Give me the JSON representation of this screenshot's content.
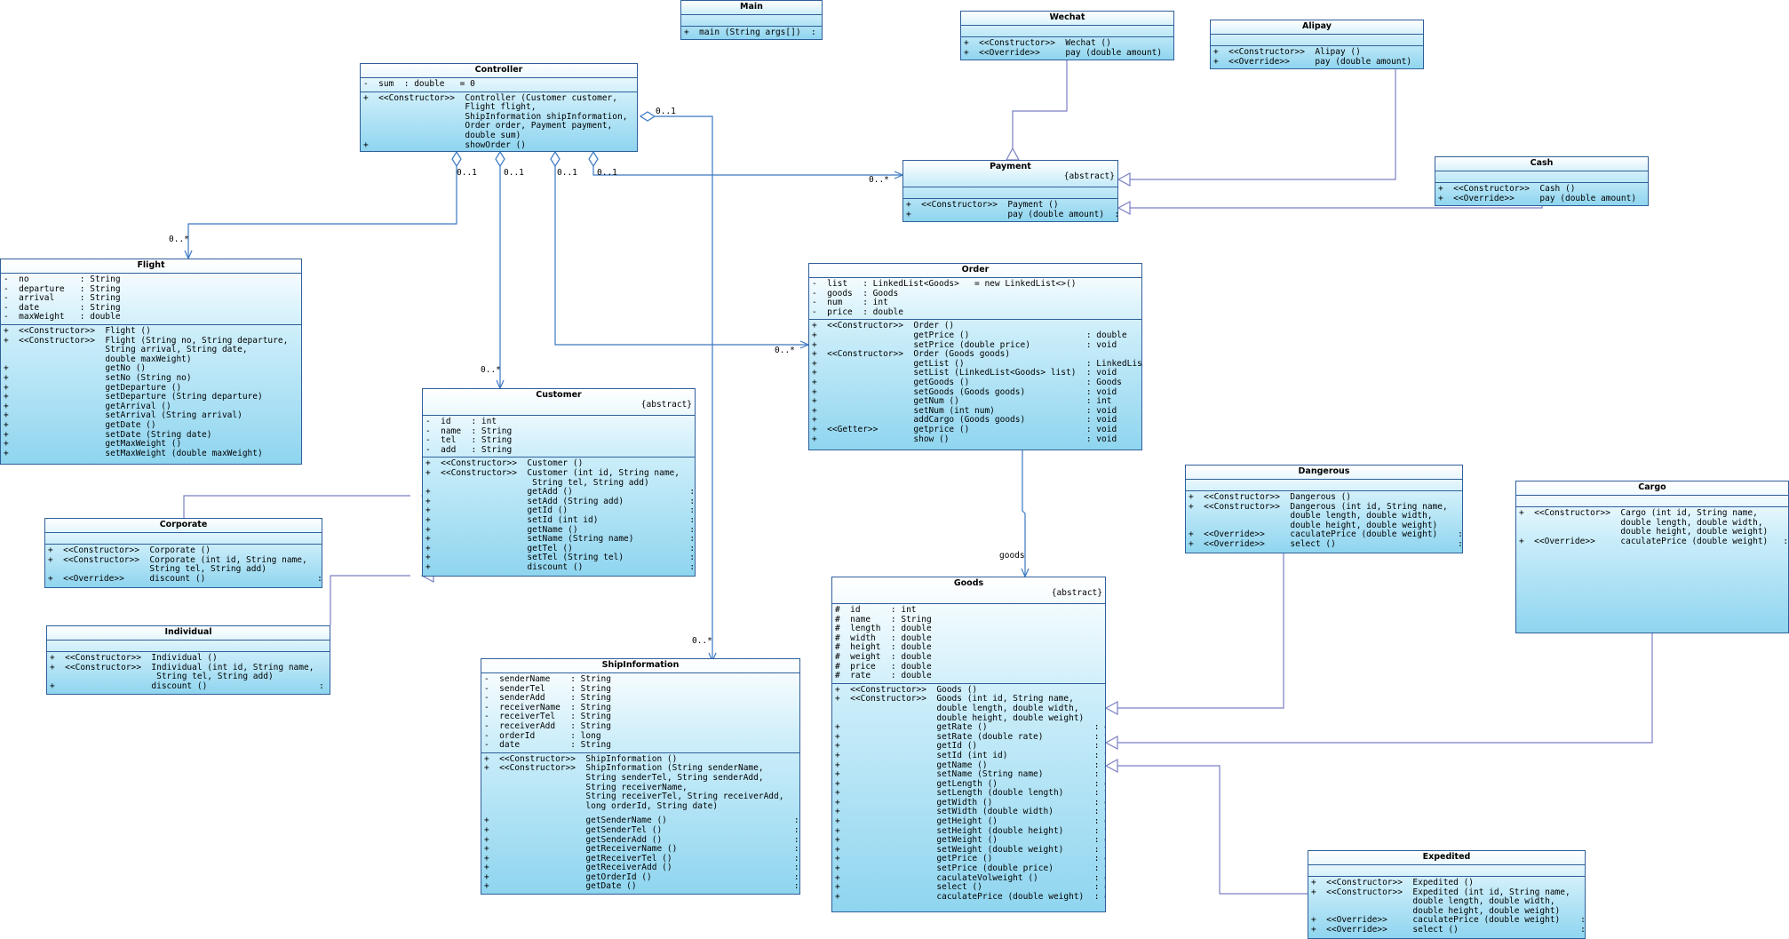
{
  "classes": [
    {
      "key": "Main",
      "name": "Main",
      "stereotype": "",
      "attrs": [],
      "ops": [
        "+  main (String args[])  : void"
      ]
    },
    {
      "key": "Wechat",
      "name": "Wechat",
      "stereotype": "",
      "attrs": [],
      "ops": [
        "+  <<Constructor>>  Wechat ()",
        "+  <<Override>>     pay (double amount)  : void"
      ]
    },
    {
      "key": "Alipay",
      "name": "Alipay",
      "stereotype": "",
      "attrs": [],
      "ops": [
        "+  <<Constructor>>  Alipay ()",
        "+  <<Override>>     pay (double amount)  : void"
      ]
    },
    {
      "key": "Controller",
      "name": "Controller",
      "stereotype": "",
      "attrs": [
        "-  sum  : double   = 0"
      ],
      "ops": [
        "+  <<Constructor>>  Controller (Customer customer,",
        "                    Flight flight,",
        "                    ShipInformation shipInformation,",
        "                    Order order, Payment payment,",
        "                    double sum)",
        "+                   showOrder ()                         : void"
      ]
    },
    {
      "key": "Payment",
      "name": "Payment",
      "stereotype": "{abstract}",
      "attrs": [],
      "ops": [
        "+  <<Constructor>>  Payment ()",
        "+                   pay (double amount)  : void"
      ]
    },
    {
      "key": "Cash",
      "name": "Cash",
      "stereotype": "",
      "attrs": [],
      "ops": [
        "+  <<Constructor>>  Cash ()",
        "+  <<Override>>     pay (double amount)  : void"
      ]
    },
    {
      "key": "Flight",
      "name": "Flight",
      "stereotype": "",
      "attrs": [
        "-  no          : String",
        "-  departure   : String",
        "-  arrival     : String",
        "-  date        : String",
        "-  maxWeight   : double"
      ],
      "ops": [
        "+  <<Constructor>>  Flight ()",
        "+  <<Constructor>>  Flight (String no, String departure,",
        "                    String arrival, String date,",
        "                    double maxWeight)",
        "+                   getNo ()                                : String",
        "+                   setNo (String no)                       : void",
        "+                   getDeparture ()                         : String",
        "+                   setDeparture (String departure)         : void",
        "+                   getArrival ()                           : String",
        "+                   setArrival (String arrival)             : void",
        "+                   getDate ()                              : String",
        "+                   setDate (String date)                   : void",
        "+                   getMaxWeight ()                         : double",
        "+                   setMaxWeight (double maxWeight)         : void"
      ]
    },
    {
      "key": "Order",
      "name": "Order",
      "stereotype": "",
      "attrs": [
        "-  list   : LinkedList<Goods>   = new LinkedList<>()",
        "-  goods  : Goods",
        "-  num    : int",
        "-  price  : double"
      ],
      "ops": [
        "+  <<Constructor>>  Order ()",
        "+                   getPrice ()                       : double",
        "+                   setPrice (double price)           : void",
        "+  <<Constructor>>  Order (Goods goods)",
        "+                   getList ()                        : LinkedList<Goods>",
        "+                   setList (LinkedList<Goods> list)  : void",
        "+                   getGoods ()                       : Goods",
        "+                   setGoods (Goods goods)            : void",
        "+                   getNum ()                         : int",
        "+                   setNum (int num)                  : void",
        "+                   addCargo (Goods goods)            : void",
        "+  <<Getter>>       getprice ()                       : void",
        "+                   show ()                           : void"
      ]
    },
    {
      "key": "Customer",
      "name": "Customer",
      "stereotype": "{abstract}",
      "attrs": [
        "-  id    : int",
        "-  name  : String",
        "-  tel   : String",
        "-  add   : String"
      ],
      "ops": [
        "+  <<Constructor>>  Customer ()",
        "+  <<Constructor>>  Customer (int id, String name,",
        "                     String tel, String add)",
        "+                   getAdd ()                       : String",
        "+                   setAdd (String add)             : void",
        "+                   getId ()                        : int",
        "+                   setId (int id)                  : void",
        "+                   getName ()                      : String",
        "+                   setName (String name)           : void",
        "+                   getTel ()                       : String",
        "+                   setTel (String tel)             : void",
        "+                   discount ()                     : double"
      ]
    },
    {
      "key": "Corporate",
      "name": "Corporate",
      "stereotype": "",
      "attrs": [],
      "ops": [
        "+  <<Constructor>>  Corporate ()",
        "+  <<Constructor>>  Corporate (int id, String name,",
        "                    String tel, String add)",
        "+  <<Override>>     discount ()                      : double"
      ]
    },
    {
      "key": "Individual",
      "name": "Individual",
      "stereotype": "",
      "attrs": [],
      "ops": [
        "+  <<Constructor>>  Individual ()",
        "+  <<Constructor>>  Individual (int id, String name,",
        "                     String tel, String add)",
        "+                   discount ()                      : double"
      ]
    },
    {
      "key": "ShipInformation",
      "name": "ShipInformation",
      "stereotype": "",
      "attrs": [
        "-  senderName    : String",
        "-  senderTel     : String",
        "-  senderAdd     : String",
        "-  receiverName  : String",
        "-  receiverTel   : String",
        "-  receiverAdd   : String",
        "-  orderId       : long",
        "-  date          : String"
      ],
      "ops": [
        "+  <<Constructor>>  ShipInformation ()",
        "+  <<Constructor>>  ShipInformation (String senderName,",
        "                    String senderTel, String senderAdd,",
        "                    String receiverName,",
        "                    String receiverTel, String receiverAdd,",
        "                    long orderId, String date)",
        "",
        "+                   getSenderName ()                         : String",
        "+                   getSenderTel ()                          : String",
        "+                   getSenderAdd ()                          : String",
        "+                   getReceiverName ()                       : String",
        "+                   getReceiverTel ()                        : String",
        "+                   getReceiverAdd ()                        : String",
        "+                   getOrderId ()                            : long",
        "+                   getDate ()                               : String"
      ]
    },
    {
      "key": "Dangerous",
      "name": "Dangerous",
      "stereotype": "",
      "attrs": [],
      "ops": [
        "+  <<Constructor>>  Dangerous ()",
        "+  <<Constructor>>  Dangerous (int id, String name,",
        "                    double length, double width,",
        "                    double height, double weight)",
        "+  <<Override>>     caculatePrice (double weight)    : double",
        "+  <<Override>>     select ()                        : double"
      ]
    },
    {
      "key": "Cargo",
      "name": "Cargo",
      "stereotype": "",
      "attrs": [],
      "ops": [
        "+  <<Constructor>>  Cargo (int id, String name,",
        "                    double length, double width,",
        "                    double height, double weight)",
        "+  <<Override>>     caculatePrice (double weight)   : double"
      ]
    },
    {
      "key": "Goods",
      "name": "Goods",
      "stereotype": "{abstract}",
      "attrs": [
        "#  id      : int",
        "#  name    : String",
        "#  length  : double",
        "#  width   : double",
        "#  height  : double",
        "#  weight  : double",
        "#  price   : double",
        "#  rate    : double"
      ],
      "ops": [
        "+  <<Constructor>>  Goods ()",
        "+  <<Constructor>>  Goods (int id, String name,",
        "                    double length, double width,",
        "                    double height, double weight)",
        "+                   getRate ()                     : double",
        "+                   setRate (double rate)          : void",
        "+                   getId ()                       : int",
        "+                   setId (int id)                 : void",
        "+                   getName ()                     : String",
        "+                   setName (String name)          : void",
        "+                   getLength ()                   : double",
        "+                   setLength (double length)      : void",
        "+                   getWidth ()                    : double",
        "+                   setWidth (double width)        : void",
        "+                   getHeight ()                   : double",
        "+                   setHeight (double height)      : void",
        "+                   getWeight ()                   : double",
        "+                   setWeight (double weight)      : void",
        "+                   getPrice ()                    : double",
        "+                   setPrice (double price)        : void",
        "+                   caculateVolweight ()           : double",
        "+                   select ()                      : double",
        "+                   caculatePrice (double weight)  : double"
      ]
    },
    {
      "key": "Expedited",
      "name": "Expedited",
      "stereotype": "",
      "attrs": [],
      "ops": [
        "+  <<Constructor>>  Expedited ()",
        "+  <<Constructor>>  Expedited (int id, String name,",
        "                    double length, double width,",
        "                    double height, double weight)",
        "+  <<Override>>     caculatePrice (double weight)    : double",
        "+  <<Override>>     select ()                        : double"
      ]
    }
  ],
  "multiplicities": [
    {
      "key": "m_ctrl_ship",
      "text": "0..1"
    },
    {
      "key": "m_ctrl_flight",
      "text": "0..1"
    },
    {
      "key": "m_ctrl_cust",
      "text": "0..1"
    },
    {
      "key": "m_ctrl_order",
      "text": "0..1"
    },
    {
      "key": "m_ctrl_pay",
      "text": "0..1"
    },
    {
      "key": "m_flight",
      "text": "0..*"
    },
    {
      "key": "m_cust",
      "text": "0..*"
    },
    {
      "key": "m_order",
      "text": "0..*"
    },
    {
      "key": "m_pay",
      "text": "0..*"
    },
    {
      "key": "m_ship",
      "text": "0..*"
    },
    {
      "key": "m_goods",
      "text": "goods"
    }
  ],
  "colors": {
    "line": "#3a78c2",
    "inherit": "#7b7fc4",
    "border": "#2f5f9a"
  }
}
